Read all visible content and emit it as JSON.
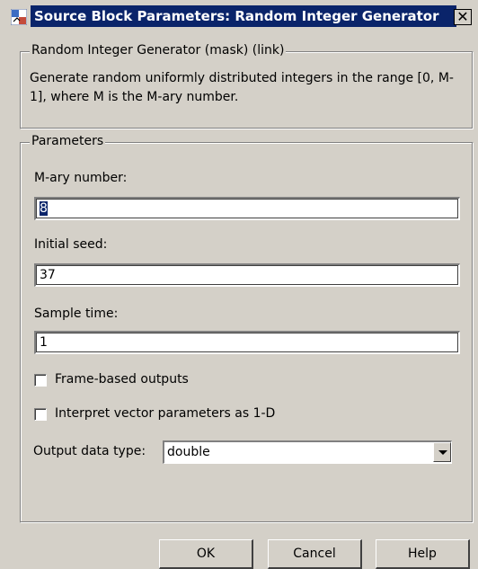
{
  "window": {
    "title": "Source Block Parameters: Random Integer Generator",
    "close_glyph": "✕"
  },
  "block_group": {
    "legend": "Random Integer Generator (mask) (link)",
    "description": "Generate random uniformly distributed integers in the range [0, M-1], where M is the M-ary number."
  },
  "parameters": {
    "legend": "Parameters",
    "mary": {
      "label": "M-ary number:",
      "value": "8"
    },
    "seed": {
      "label": "Initial seed:",
      "value": "37"
    },
    "sample_time": {
      "label": "Sample time:",
      "value": "1"
    },
    "frame_based": {
      "label": "Frame-based outputs",
      "checked": false
    },
    "interpret_vector": {
      "label": "Interpret vector parameters as 1-D",
      "checked": false
    },
    "output_type": {
      "label": "Output data type:",
      "value": "double"
    }
  },
  "buttons": {
    "ok": "OK",
    "cancel": "Cancel",
    "help": "Help"
  },
  "icons": {
    "app": "simulink-block-icon",
    "dropdown": "chevron-down-icon"
  }
}
